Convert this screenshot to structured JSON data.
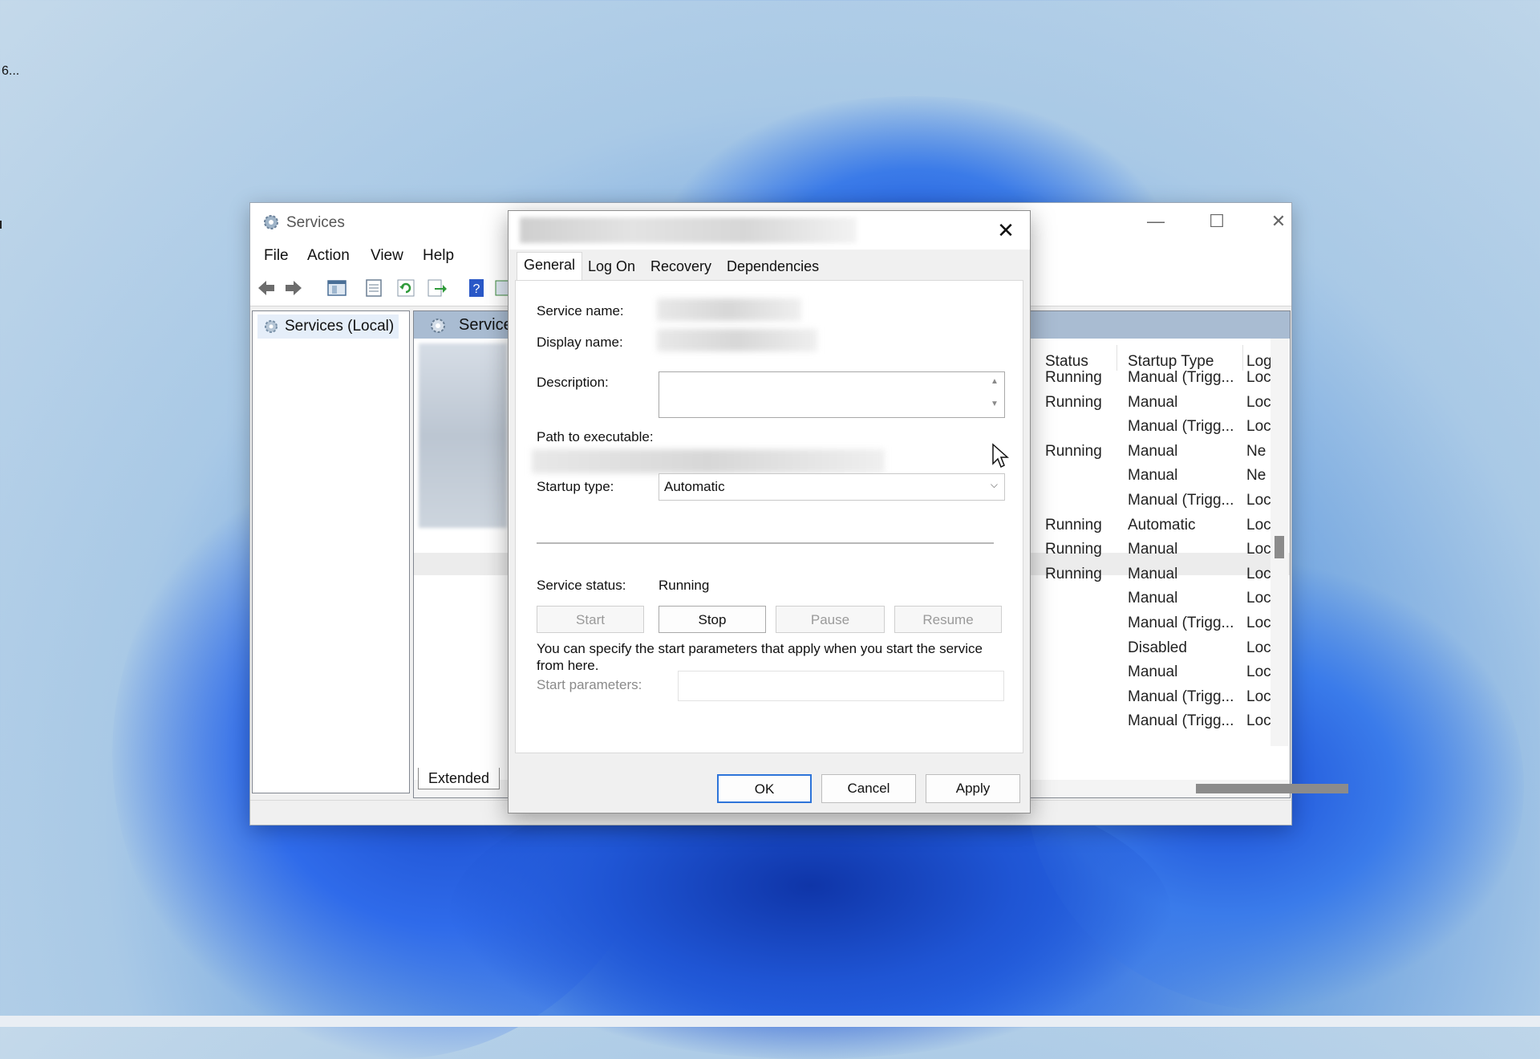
{
  "desktop": {
    "icon_label": "6..."
  },
  "services_window": {
    "title": "Services",
    "controls": {
      "minimize": "—",
      "maximize": "☐",
      "close": "✕"
    },
    "menu": [
      "File",
      "Action",
      "View",
      "Help"
    ],
    "tree_item": "Services (Local)",
    "content_header": "Services",
    "columns": [
      "Status",
      "Startup Type",
      "Log"
    ],
    "rows": [
      {
        "status": "Running",
        "startup": "Manual (Trigg...",
        "log": "Loc"
      },
      {
        "status": "Running",
        "startup": "Manual",
        "log": "Loc"
      },
      {
        "status": "",
        "startup": "Manual (Trigg...",
        "log": "Loc"
      },
      {
        "status": "Running",
        "startup": "Manual",
        "log": "Ne"
      },
      {
        "status": "",
        "startup": "Manual",
        "log": "Ne"
      },
      {
        "status": "",
        "startup": "Manual (Trigg...",
        "log": "Loc"
      },
      {
        "status": "Running",
        "startup": "Automatic",
        "log": "Loc"
      },
      {
        "status": "Running",
        "startup": "Manual",
        "log": "Loc",
        "selected": true
      },
      {
        "status": "Running",
        "startup": "Manual",
        "log": "Loc"
      },
      {
        "status": "",
        "startup": "Manual",
        "log": "Loc"
      },
      {
        "status": "",
        "startup": "Manual (Trigg...",
        "log": "Loc"
      },
      {
        "status": "",
        "startup": "Disabled",
        "log": "Loc"
      },
      {
        "status": "",
        "startup": "Manual",
        "log": "Loc"
      },
      {
        "status": "",
        "startup": "Manual (Trigg...",
        "log": "Loc"
      },
      {
        "status": "",
        "startup": "Manual (Trigg...",
        "log": "Loc"
      }
    ],
    "bottom_tab": "Extended"
  },
  "dialog": {
    "close": "✕",
    "tabs": [
      "General",
      "Log On",
      "Recovery",
      "Dependencies"
    ],
    "active_tab": "General",
    "labels": {
      "service_name": "Service name:",
      "display_name": "Display name:",
      "description": "Description:",
      "path": "Path to executable:",
      "startup_type": "Startup type:",
      "service_status": "Service status:",
      "start_params": "Start parameters:"
    },
    "startup_type_value": "Automatic",
    "service_status_value": "Running",
    "buttons": {
      "start": "Start",
      "stop": "Stop",
      "pause": "Pause",
      "resume": "Resume"
    },
    "help_text": "You can specify the start parameters that apply when you start the service from here.",
    "footer": {
      "ok": "OK",
      "cancel": "Cancel",
      "apply": "Apply"
    }
  },
  "colors": {
    "accent": "#2d74d9",
    "header_band": "#a9bcd2"
  }
}
